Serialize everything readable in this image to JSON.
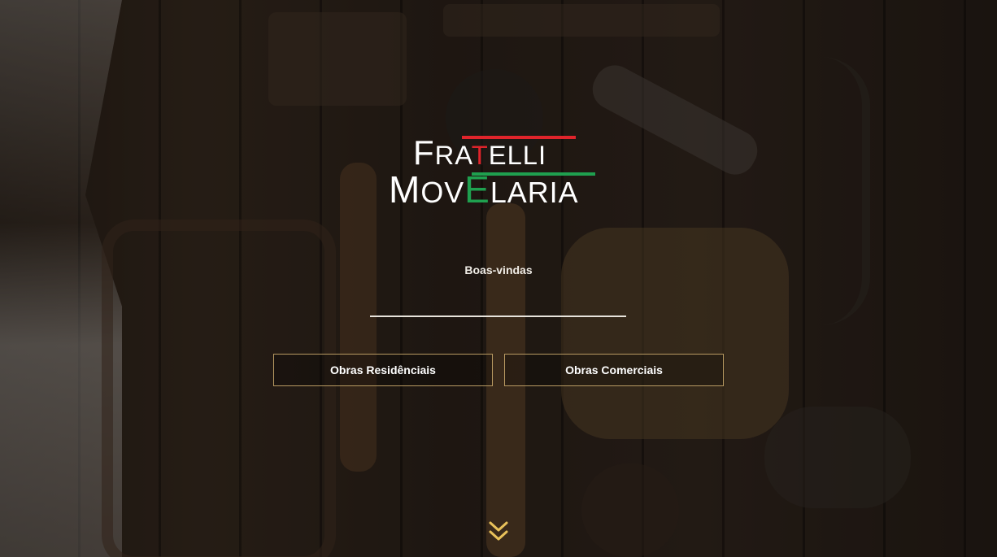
{
  "brand": {
    "line1_first": "F",
    "line1_rest": "RA",
    "line1_accent": "T",
    "line1_tail": "ELLI",
    "line2_first": "M",
    "line2_rest": "OV",
    "line2_accent": "E",
    "line2_tail": "LARIA",
    "colors": {
      "red": "#e0242b",
      "green": "#1fa04f"
    }
  },
  "hero": {
    "welcome": "Boas-vindas"
  },
  "buttons": {
    "residential": "Obras Residênciais",
    "commercial": "Obras Comerciais"
  },
  "icons": {
    "scroll": "double-chevron-down-icon"
  },
  "theme": {
    "accent": "#b89a62",
    "chevron": "#e8c15a"
  }
}
